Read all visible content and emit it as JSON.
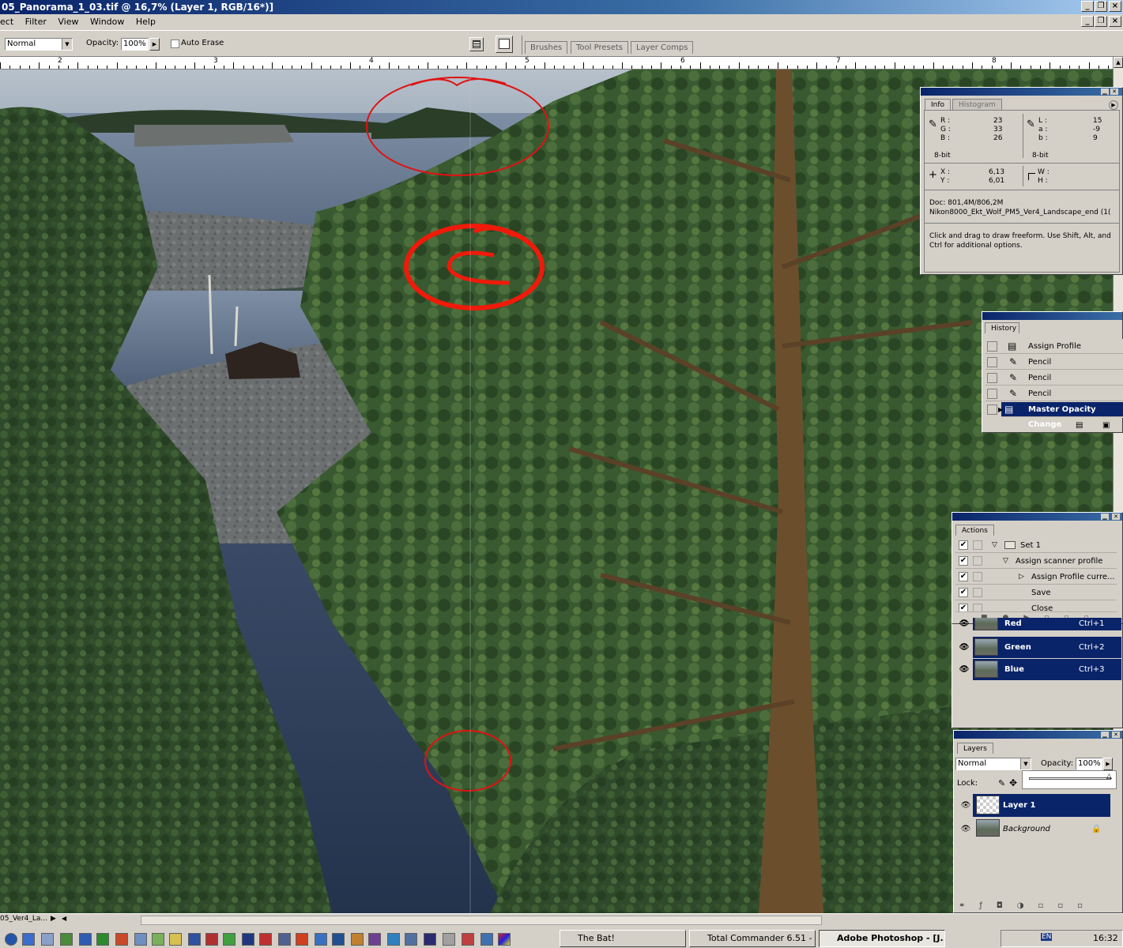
{
  "window": {
    "title": "05_Panorama_1_03.tif @ 16,7% (Layer 1, RGB/16*)]",
    "buttons": [
      "_",
      "❐",
      "×"
    ]
  },
  "menu": [
    "ect",
    "Filter",
    "View",
    "Window",
    "Help"
  ],
  "options": {
    "mode": "Normal",
    "opacity_label": "Opacity:",
    "opacity_value": "100%",
    "auto_erase": "Auto Erase",
    "well_tabs": [
      "Brushes",
      "Tool Presets",
      "Layer Comps"
    ]
  },
  "ruler": {
    "labels": [
      "2",
      "3",
      "4",
      "5",
      "6",
      "7",
      "8"
    ]
  },
  "info_panel": {
    "tabs": [
      "Info",
      "Histogram"
    ],
    "left": {
      "r_label": "R :",
      "g_label": "G :",
      "b_label": "B :",
      "r": "23",
      "g": "33",
      "b": "26",
      "depth": "8-bit"
    },
    "right": {
      "l_label": "L :",
      "a_label": "a :",
      "bb_label": "b :",
      "l": "15",
      "a": "-9",
      "b": "9",
      "depth": "8-bit"
    },
    "xy": {
      "x_label": "X :",
      "y_label": "Y :",
      "x": "6,13",
      "y": "6,01"
    },
    "wh": {
      "w_label": "W :",
      "h_label": "H :"
    },
    "doc": "Doc: 801,4M/806,2M",
    "profile": "Nikon8000_Ekt_Wolf_PM5_Ver4_Landscape_end (1(",
    "hint": "Click and drag to draw freeform. Use Shift, Alt, and Ctrl for additional options."
  },
  "history_panel": {
    "tab": "History",
    "items": [
      "Assign Profile",
      "Pencil",
      "Pencil",
      "Pencil",
      "Master Opacity Change"
    ]
  },
  "actions_panel": {
    "tab": "Actions",
    "items": [
      "Set 1",
      "Assign scanner profile",
      "Assign Profile curre...",
      "Save",
      "Close"
    ]
  },
  "channels_panel": {
    "items": [
      {
        "name": "Red",
        "shortcut": "Ctrl+1"
      },
      {
        "name": "Green",
        "shortcut": "Ctrl+2"
      },
      {
        "name": "Blue",
        "shortcut": "Ctrl+3"
      }
    ]
  },
  "layers_panel": {
    "tab": "Layers",
    "mode": "Normal",
    "opacity_label": "Opacity:",
    "opacity_value": "100%",
    "lock_label": "Lock:",
    "layers": [
      "Layer 1",
      "Background"
    ]
  },
  "taskbar": {
    "left_doc": "05_Ver4_La...",
    "tasks": [
      "The Bat!",
      "Total Commander 6.51 - ...",
      "Adobe Photoshop - [J..."
    ],
    "lang": "EN",
    "time": "16:32"
  }
}
